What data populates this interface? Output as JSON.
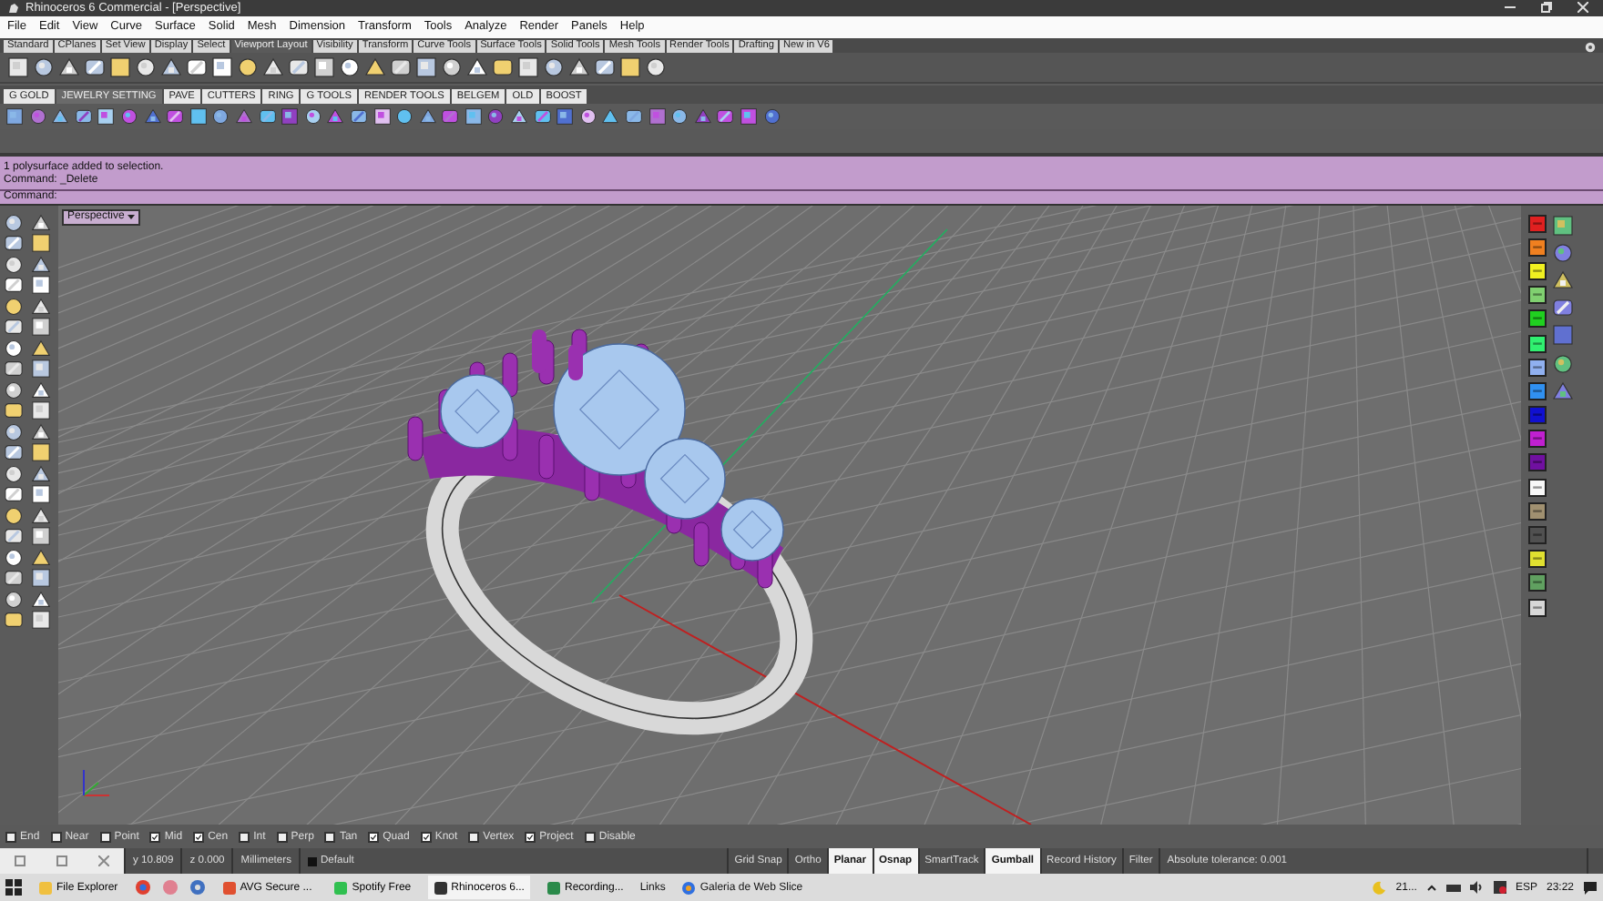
{
  "window": {
    "title": "Rhinoceros 6 Commercial - [Perspective]"
  },
  "menu": [
    "File",
    "Edit",
    "View",
    "Curve",
    "Surface",
    "Solid",
    "Mesh",
    "Dimension",
    "Transform",
    "Tools",
    "Analyze",
    "Render",
    "Panels",
    "Help"
  ],
  "toolbar_tabs": [
    {
      "label": "Standard",
      "selected": false
    },
    {
      "label": "CPlanes",
      "selected": false
    },
    {
      "label": "Set View",
      "selected": false
    },
    {
      "label": "Display",
      "selected": false
    },
    {
      "label": "Select",
      "selected": false
    },
    {
      "label": "Viewport Layout",
      "selected": true
    },
    {
      "label": "Visibility",
      "selected": false
    },
    {
      "label": "Transform",
      "selected": false
    },
    {
      "label": "Curve Tools",
      "selected": false
    },
    {
      "label": "Surface Tools",
      "selected": false
    },
    {
      "label": "Solid Tools",
      "selected": false
    },
    {
      "label": "Mesh Tools",
      "selected": false
    },
    {
      "label": "Render Tools",
      "selected": false
    },
    {
      "label": "Drafting",
      "selected": false
    },
    {
      "label": "New in V6",
      "selected": false
    }
  ],
  "plugin_tabs": [
    {
      "label": "G GOLD",
      "selected": false
    },
    {
      "label": "JEWELRY SETTING",
      "selected": true
    },
    {
      "label": "PAVE",
      "selected": false
    },
    {
      "label": "CUTTERS",
      "selected": false
    },
    {
      "label": "RING",
      "selected": false
    },
    {
      "label": "G TOOLS",
      "selected": false
    },
    {
      "label": "RENDER TOOLS",
      "selected": false
    },
    {
      "label": "BELGEM",
      "selected": false
    },
    {
      "label": "OLD",
      "selected": false
    },
    {
      "label": "BOOST",
      "selected": false
    }
  ],
  "command_history": [
    "1 polysurface added to selection.",
    "Command: _Delete"
  ],
  "command_prompt": "Command:",
  "viewport": {
    "title": "Perspective"
  },
  "osnaps": [
    {
      "label": "End",
      "checked": false
    },
    {
      "label": "Near",
      "checked": false
    },
    {
      "label": "Point",
      "checked": false
    },
    {
      "label": "Mid",
      "checked": true
    },
    {
      "label": "Cen",
      "checked": true
    },
    {
      "label": "Int",
      "checked": false
    },
    {
      "label": "Perp",
      "checked": false
    },
    {
      "label": "Tan",
      "checked": false
    },
    {
      "label": "Quad",
      "checked": true
    },
    {
      "label": "Knot",
      "checked": true
    },
    {
      "label": "Vertex",
      "checked": false
    },
    {
      "label": "Project",
      "checked": true
    },
    {
      "label": "Disable",
      "checked": false
    }
  ],
  "status_bar": {
    "coords": [
      "y 10.809",
      "z 0.000"
    ],
    "units": "Millimeters",
    "layer": "Default",
    "toggles": [
      {
        "label": "Grid Snap",
        "on": false
      },
      {
        "label": "Ortho",
        "on": false
      },
      {
        "label": "Planar",
        "on": true
      },
      {
        "label": "Osnap",
        "on": true
      },
      {
        "label": "SmartTrack",
        "on": false
      },
      {
        "label": "Gumball",
        "on": true
      },
      {
        "label": "Record History",
        "on": false
      },
      {
        "label": "Filter",
        "on": false
      }
    ],
    "tolerance": "Absolute tolerance: 0.001"
  },
  "taskbar": {
    "apps": [
      {
        "label": "File Explorer",
        "selected": false
      },
      {
        "label": "AVG Secure ...",
        "selected": false
      },
      {
        "label": "Spotify Free",
        "selected": false
      },
      {
        "label": "Rhinoceros 6...",
        "selected": true
      },
      {
        "label": "Recording...",
        "selected": false
      }
    ],
    "links": "Links",
    "web_slice": "Galeria de Web Slice",
    "tray": [
      "21...",
      "ESP",
      "23:22"
    ]
  }
}
